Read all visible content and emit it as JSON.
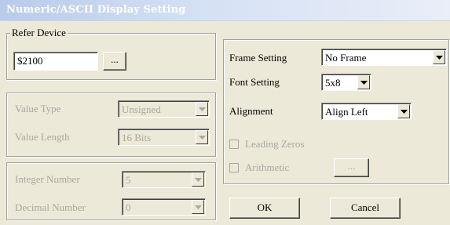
{
  "window": {
    "title": "Numeric/ASCII Display Setting"
  },
  "refer_device": {
    "legend": "Refer Device",
    "value": "$2100",
    "browse_label": "..."
  },
  "value_group": {
    "value_type": {
      "label": "Value Type",
      "selected": "Unsigned"
    },
    "value_length": {
      "label": "Value Length",
      "selected": "16 Bits"
    }
  },
  "number_group": {
    "integer_number": {
      "label": "Integer Number",
      "selected": "5"
    },
    "decimal_number": {
      "label": "Decimal Number",
      "selected": "0"
    }
  },
  "right_group": {
    "frame_setting": {
      "label": "Frame Setting",
      "selected": "No Frame"
    },
    "font_setting": {
      "label": "Font Setting",
      "selected": "5x8"
    },
    "alignment": {
      "label": "Alignment",
      "selected": "Align Left"
    },
    "leading_zeros": {
      "label": "Leading Zeros",
      "checked": false
    },
    "arithmetic": {
      "label": "Arithmetic",
      "checked": false,
      "button_label": "..."
    }
  },
  "buttons": {
    "ok": "OK",
    "cancel": "Cancel"
  }
}
